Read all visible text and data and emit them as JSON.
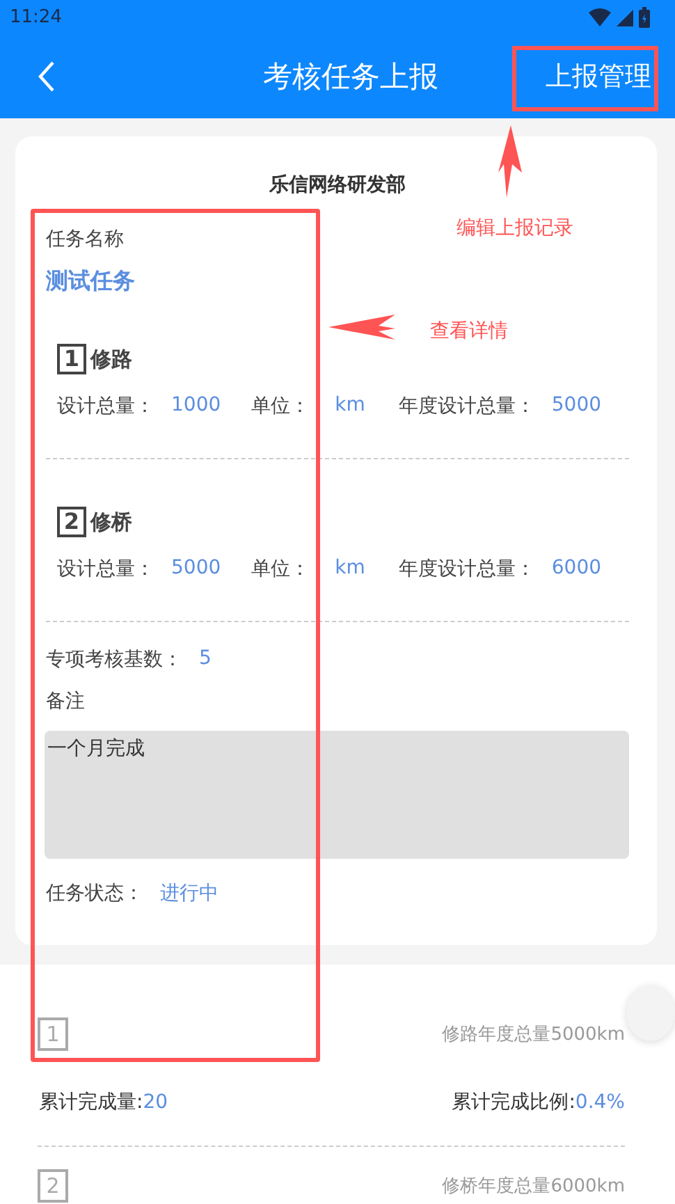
{
  "status_bar": {
    "time": "11:24"
  },
  "header": {
    "title": "考核任务上报",
    "action": "上报管理"
  },
  "card": {
    "department": "乐信网络研发部",
    "task_name_label": "任务名称",
    "task_name": "测试任务",
    "items": [
      {
        "number": "1",
        "name": "修路",
        "fields": [
          {
            "label": "设计总量：",
            "value": "1000"
          },
          {
            "label": "单位：",
            "value": "km"
          },
          {
            "label": "年度设计总量：",
            "value": "5000"
          }
        ]
      },
      {
        "number": "2",
        "name": "修桥",
        "fields": [
          {
            "label": "设计总量：",
            "value": "5000"
          },
          {
            "label": "单位：",
            "value": "km"
          },
          {
            "label": "年度设计总量：",
            "value": "6000"
          }
        ]
      }
    ],
    "base_count": {
      "label": "专项考核基数：",
      "value": "5"
    },
    "remark": {
      "label": "备注",
      "value": "一个月完成"
    },
    "status": {
      "label": "任务状态：",
      "value": "进行中"
    }
  },
  "progress": [
    {
      "number": "1",
      "annual_total": "修路年度总量5000km",
      "completed": {
        "label": "累计完成量:",
        "value": "20"
      },
      "ratio": {
        "label": "累计完成比例:",
        "value": "0.4%"
      }
    },
    {
      "number": "2",
      "annual_total": "修桥年度总量6000km"
    }
  ],
  "annotations": [
    {
      "text": "编辑上报记录"
    },
    {
      "text": "查看详情"
    }
  ]
}
